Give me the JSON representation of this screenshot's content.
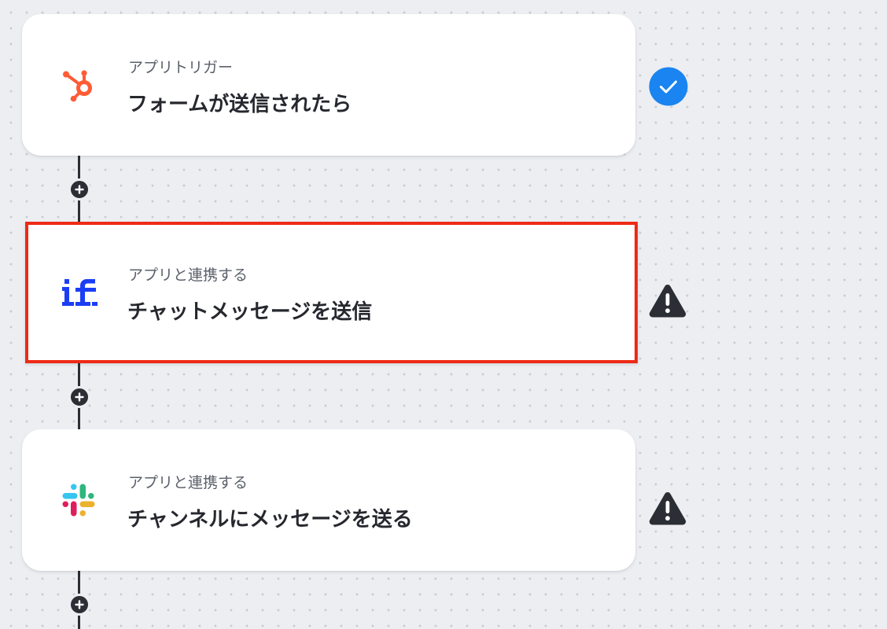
{
  "colors": {
    "check": "#1a84f0",
    "warning": "#2b2e35",
    "selection_border": "#ee2a16",
    "hubspot": "#ff5c35",
    "if_logo": "#1b3ef5"
  },
  "steps": [
    {
      "app_icon": "hubspot-icon",
      "label": "アプリトリガー",
      "title": "フォームが送信されたら",
      "status": "check-circle-icon"
    },
    {
      "app_icon": "if-logo-icon",
      "label": "アプリと連携する",
      "title": "チャットメッセージを送信",
      "status": "warning-icon",
      "selected": true
    },
    {
      "app_icon": "slack-icon",
      "label": "アプリと連携する",
      "title": "チャンネルにメッセージを送る",
      "status": "warning-icon"
    }
  ],
  "add_step_icon": "plus-icon"
}
